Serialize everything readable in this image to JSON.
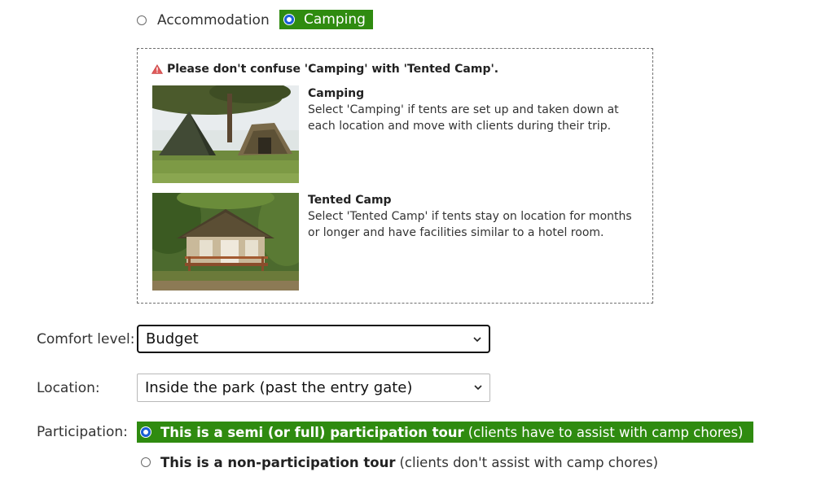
{
  "tour_type": {
    "options": [
      {
        "label": "Accommodation",
        "selected": false
      },
      {
        "label": "Camping",
        "selected": true
      }
    ]
  },
  "info_box": {
    "warning": "Please don't confuse 'Camping' with 'Tented Camp'.",
    "items": [
      {
        "title": "Camping",
        "description": "Select 'Camping' if tents are set up and taken down at each location and move with clients during their trip."
      },
      {
        "title": "Tented Camp",
        "description": "Select 'Tented Camp' if tents stay on location for months or longer and have facilities similar to a hotel room."
      }
    ]
  },
  "comfort_level": {
    "label": "Comfort level:",
    "value": "Budget"
  },
  "location": {
    "label": "Location:",
    "value": "Inside the park (past the entry gate)"
  },
  "participation": {
    "label": "Participation:",
    "options": [
      {
        "bold": "This is a semi (or full) participation tour",
        "detail": "(clients have to assist with camp chores)",
        "selected": true
      },
      {
        "bold": "This is a non-participation tour",
        "detail": "(clients don't assist with camp chores)",
        "selected": false
      }
    ]
  },
  "colors": {
    "selected_bg": "#2f8b10",
    "radio_accent": "#1a5fd6",
    "warning_icon": "#e05a5a"
  }
}
